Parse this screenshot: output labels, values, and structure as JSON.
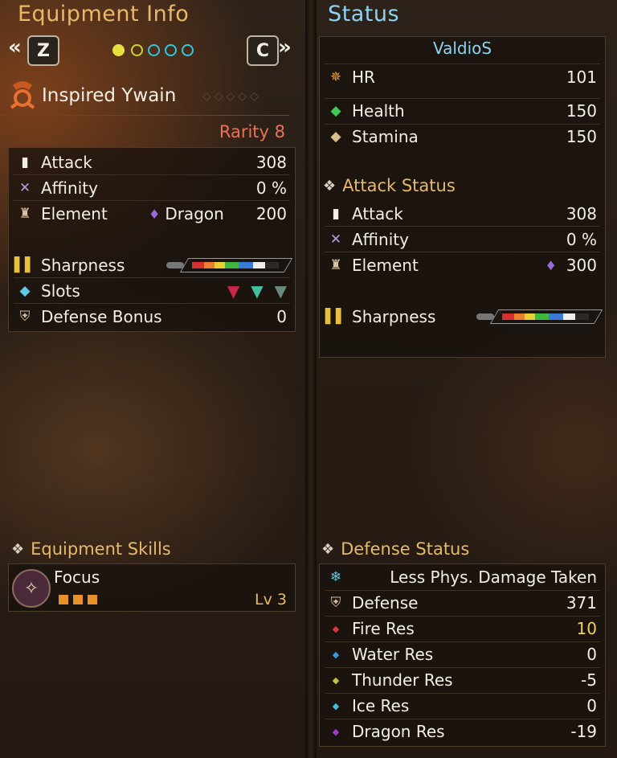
{
  "left": {
    "title": "Equipment Info",
    "prev_key": "Z",
    "next_key": "C",
    "weapon_name": "Inspired Ywain",
    "rarity": "Rarity 8",
    "stats": {
      "attack_label": "Attack",
      "attack_value": "308",
      "affinity_label": "Affinity",
      "affinity_value": "0 %",
      "element_label": "Element",
      "element_type": "Dragon",
      "element_value": "200",
      "sharpness_label": "Sharpness",
      "slots_label": "Slots",
      "defense_bonus_label": "Defense Bonus",
      "defense_bonus_value": "0"
    },
    "skills_title": "Equipment Skills",
    "skill": {
      "name": "Focus",
      "level": "Lv 3",
      "level_pips": 3
    }
  },
  "right": {
    "title": "Status",
    "player_name": "ValdioS",
    "hr_label": "HR",
    "hr_value": "101",
    "health_label": "Health",
    "health_value": "150",
    "stamina_label": "Stamina",
    "stamina_value": "150",
    "attack_status_title": "Attack Status",
    "attack_label": "Attack",
    "attack_value": "308",
    "affinity_label": "Affinity",
    "affinity_value": "0 %",
    "element_label": "Element",
    "element_value": "300",
    "sharpness_label": "Sharpness",
    "defense_status_title": "Defense Status",
    "defense_skill": "Less Phys. Damage Taken",
    "defense_label": "Defense",
    "defense_value": "371",
    "res": [
      {
        "label": "Fire Res",
        "value": "10",
        "color": "#d83a3a",
        "value_color": "#f0d060"
      },
      {
        "label": "Water Res",
        "value": "0",
        "color": "#3a9ad8",
        "value_color": "#f2efe6"
      },
      {
        "label": "Thunder Res",
        "value": "-5",
        "color": "#c8c040",
        "value_color": "#f2efe6"
      },
      {
        "label": "Ice Res",
        "value": "0",
        "color": "#40c0d8",
        "value_color": "#f2efe6"
      },
      {
        "label": "Dragon Res",
        "value": "-19",
        "color": "#9a40c8",
        "value_color": "#f2efe6"
      }
    ]
  },
  "colors": {
    "title_gold": "#e8b968",
    "title_blue": "#8fd3f2",
    "rarity": "#e8735a",
    "player_name": "#8fd3f2",
    "health": "#40c858",
    "stamina": "#d8c08a"
  }
}
